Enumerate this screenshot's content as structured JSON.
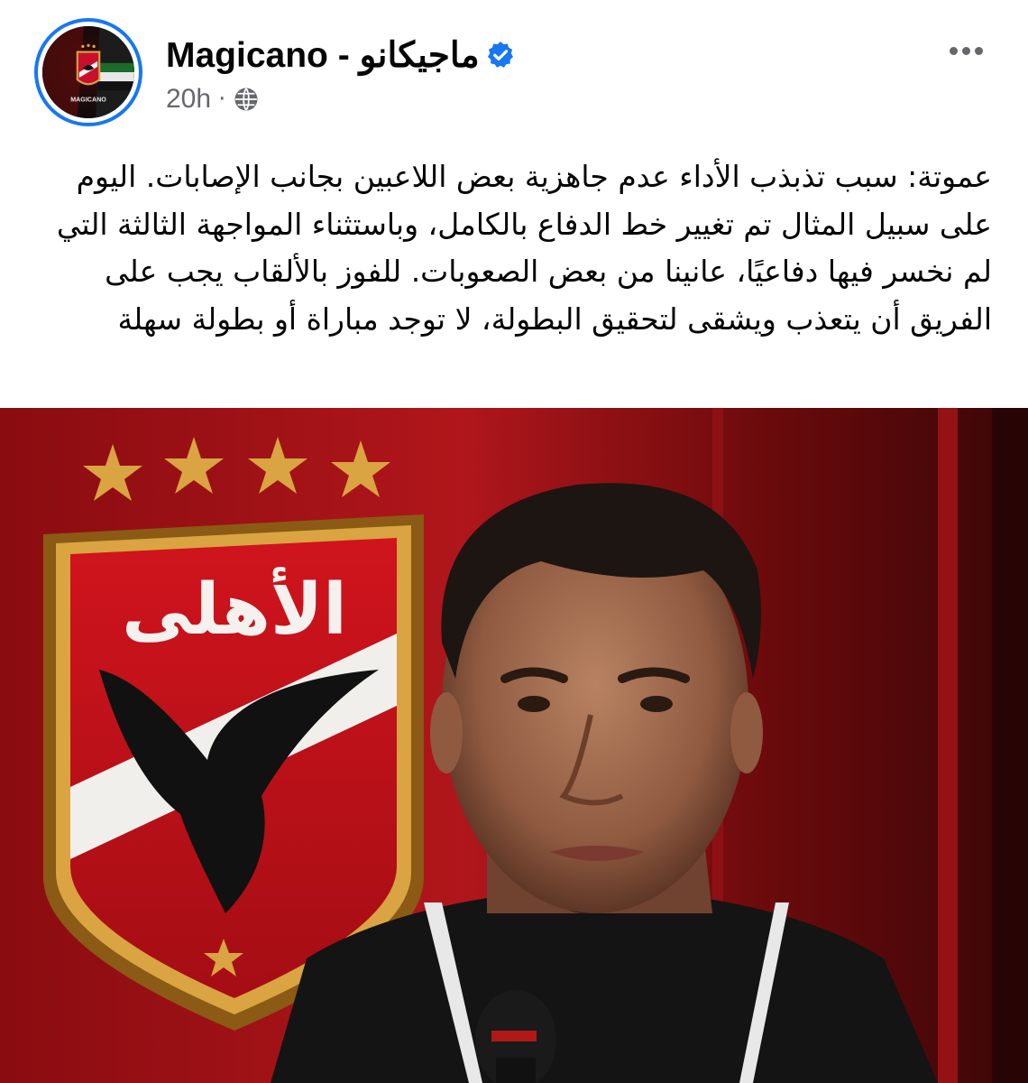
{
  "post": {
    "author_name": "Magicano - ماجيكانو",
    "time": "20h",
    "separator": "·",
    "verified": true,
    "audience_icon": "globe-icon",
    "more_icon": "more-horizontal-icon",
    "text": "عموتة: سبب تذبذب الأداء عدم جاهزية بعض اللاعبين بجانب الإصابات. اليوم على سبيل المثال تم تغيير خط الدفاع بالكامل، وباستثناء المواجهة الثالثة التي لم نخسر فيها دفاعيًا، عانينا من بعض الصعوبات. للفوز بالألقاب يجب على الفريق أن يتعذب ويشقى لتحقيق البطولة، لا توجد مباراة أو بطولة سهلة"
  },
  "avatar": {
    "logo_text": "MAGICANO"
  },
  "image": {
    "crest_text": "الأهلى"
  },
  "colors": {
    "verified_blue": "#1877f2",
    "meta_gray": "#65676b",
    "crest_red": "#c8102e",
    "crest_gold": "#d9a441"
  }
}
